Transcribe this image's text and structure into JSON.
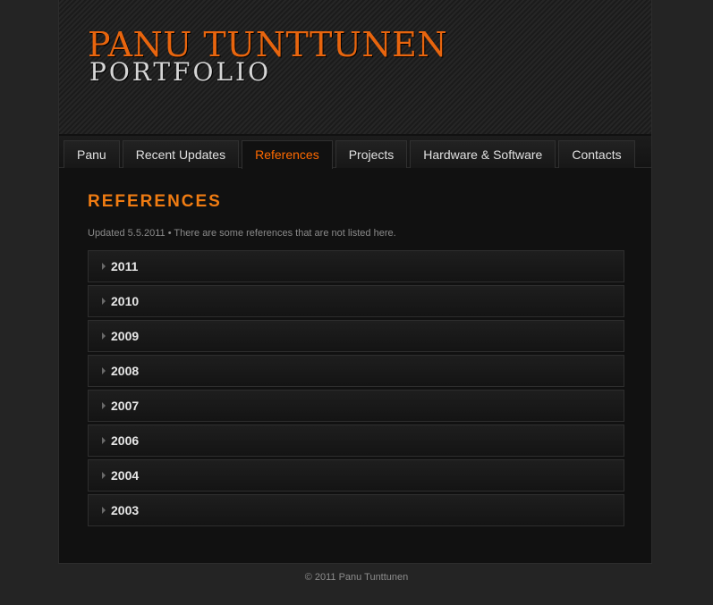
{
  "header": {
    "title": "PANU TUNTTUNEN",
    "subtitle": "PORTFOLIO"
  },
  "nav": {
    "tabs": [
      {
        "label": "Panu",
        "active": false
      },
      {
        "label": "Recent Updates",
        "active": false
      },
      {
        "label": "References",
        "active": true
      },
      {
        "label": "Projects",
        "active": false
      },
      {
        "label": "Hardware & Software",
        "active": false
      },
      {
        "label": "Contacts",
        "active": false
      }
    ]
  },
  "main": {
    "heading": "REFERENCES",
    "meta": "Updated 5.5.2011 • There are some references that are not listed here.",
    "years": [
      {
        "label": "2011",
        "icon": "triangle-right-icon"
      },
      {
        "label": "2010",
        "icon": "triangle-right-icon"
      },
      {
        "label": "2009",
        "icon": "triangle-right-icon"
      },
      {
        "label": "2008",
        "icon": "triangle-right-icon"
      },
      {
        "label": "2007",
        "icon": "triangle-right-icon"
      },
      {
        "label": "2006",
        "icon": "triangle-right-icon"
      },
      {
        "label": "2004",
        "icon": "triangle-right-icon"
      },
      {
        "label": "2003",
        "icon": "triangle-right-icon"
      }
    ]
  },
  "footer": {
    "copyright": "© 2011 Panu Tunttunen"
  },
  "colors": {
    "accent": "#f07c12",
    "active_tab": "#ff6a00",
    "background": "#242424",
    "panel": "#111111"
  }
}
